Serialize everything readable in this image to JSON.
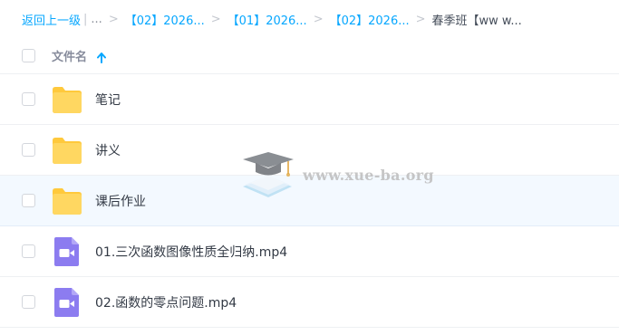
{
  "breadcrumb": {
    "back": "返回上一级",
    "pipe": "|",
    "ellipsis": "...",
    "separator": ">",
    "crumbs": [
      "【02】2026...",
      "【01】2026...",
      "【02】2026..."
    ],
    "current": "春季班【ww w..."
  },
  "list_header": {
    "name_label": "文件名",
    "sort_icon": "arrow-up-icon"
  },
  "files": [
    {
      "name": "笔记",
      "type": "folder",
      "icon": "folder-icon"
    },
    {
      "name": "讲义",
      "type": "folder",
      "icon": "folder-icon"
    },
    {
      "name": "课后作业",
      "type": "folder",
      "icon": "folder-icon"
    },
    {
      "name": "01.三次函数图像性质全归纳.mp4",
      "type": "video",
      "icon": "video-file-icon"
    },
    {
      "name": "02.函数的零点问题.mp4",
      "type": "video",
      "icon": "video-file-icon"
    }
  ],
  "watermark": {
    "text": "www.xue-ba.org",
    "icon": "graduation-cap-icon"
  },
  "colors": {
    "link": "#06a7ff",
    "folder": "#ffd35c",
    "video": "#8c7cf0",
    "hover_row": "#f3f9ff"
  }
}
